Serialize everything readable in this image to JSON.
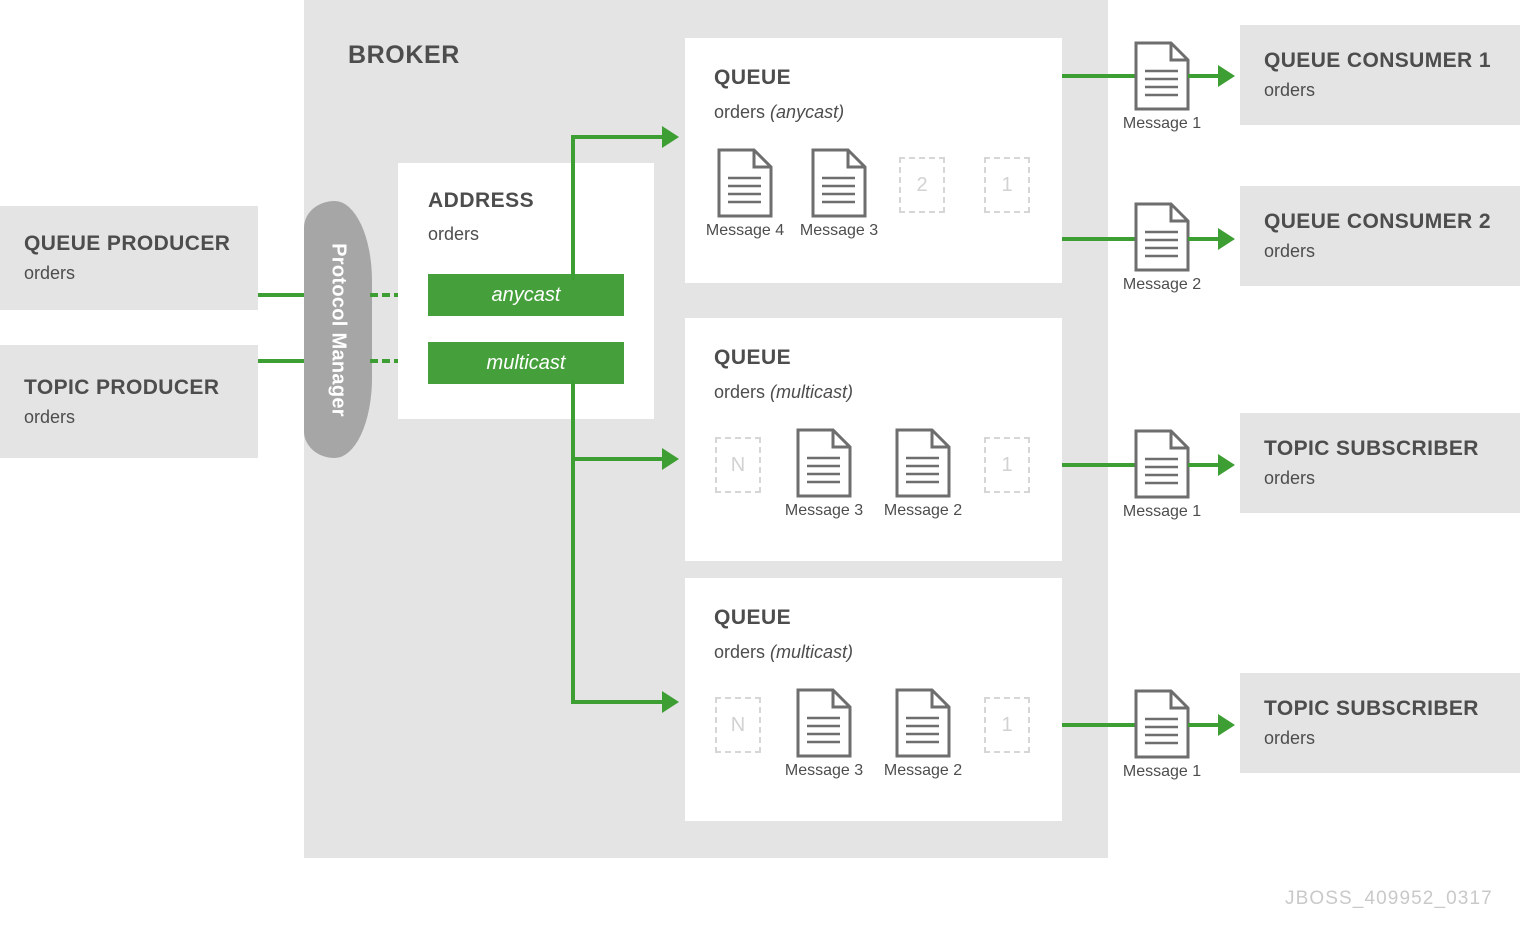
{
  "diagram": {
    "watermark": "JBOSS_409952_0317",
    "colors": {
      "green": "#45a03b",
      "wire_green": "#3d9e33",
      "light_gray": "#e4e4e4",
      "mid_gray": "#a6a6a6",
      "text_gray": "#4d4d4d",
      "ghost_gray": "#d6d6d6",
      "white": "#ffffff"
    }
  },
  "broker": {
    "title": "BROKER"
  },
  "protocol_manager": {
    "label": "Protocol Manager"
  },
  "producers": [
    {
      "title": "QUEUE PRODUCER",
      "subtitle": "orders"
    },
    {
      "title": "TOPIC PRODUCER",
      "subtitle": "orders"
    }
  ],
  "address": {
    "title": "ADDRESS",
    "subtitle": "orders",
    "routing_types": [
      {
        "label": "anycast"
      },
      {
        "label": "multicast"
      }
    ]
  },
  "queues": [
    {
      "title": "QUEUE",
      "name": "orders",
      "routing": "(anycast)",
      "messages": [
        {
          "kind": "document",
          "caption": "Message 4"
        },
        {
          "kind": "document",
          "caption": "Message 3"
        },
        {
          "kind": "ghost",
          "caption": "2"
        },
        {
          "kind": "ghost",
          "caption": "1"
        }
      ]
    },
    {
      "title": "QUEUE",
      "name": "orders",
      "routing": "(multicast)",
      "messages": [
        {
          "kind": "ghost",
          "caption": "N"
        },
        {
          "kind": "document",
          "caption": "Message 3"
        },
        {
          "kind": "document",
          "caption": "Message 2"
        },
        {
          "kind": "ghost",
          "caption": "1"
        }
      ]
    },
    {
      "title": "QUEUE",
      "name": "orders",
      "routing": "(multicast)",
      "messages": [
        {
          "kind": "ghost",
          "caption": "N"
        },
        {
          "kind": "document",
          "caption": "Message 3"
        },
        {
          "kind": "document",
          "caption": "Message 2"
        },
        {
          "kind": "ghost",
          "caption": "1"
        }
      ]
    }
  ],
  "in_flight": [
    {
      "caption": "Message 1"
    },
    {
      "caption": "Message 2"
    },
    {
      "caption": "Message 1"
    },
    {
      "caption": "Message 1"
    }
  ],
  "consumers": [
    {
      "title": "QUEUE CONSUMER 1",
      "subtitle": "orders"
    },
    {
      "title": "QUEUE CONSUMER 2",
      "subtitle": "orders"
    },
    {
      "title": "TOPIC SUBSCRIBER",
      "subtitle": "orders"
    },
    {
      "title": "TOPIC SUBSCRIBER",
      "subtitle": "orders"
    }
  ]
}
